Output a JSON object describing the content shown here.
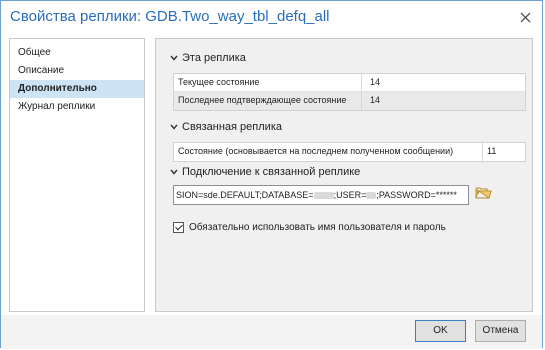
{
  "window": {
    "title": "Свойства реплики: GDB.Two_way_tbl_defq_all"
  },
  "nav": {
    "items": [
      {
        "label": "Общее",
        "active": false
      },
      {
        "label": "Описание",
        "active": false
      },
      {
        "label": "Дополнительно",
        "active": true
      },
      {
        "label": "Журнал реплики",
        "active": false
      }
    ]
  },
  "this_replica": {
    "heading": "Эта реплика",
    "rows": [
      {
        "key": "Текущее состояние",
        "value": "14"
      },
      {
        "key": "Последнее подтверждающее состояние",
        "value": "14"
      }
    ]
  },
  "related_replica": {
    "heading": "Связанная реплика",
    "rows": [
      {
        "key": "Состояние (основывается на последнем полученном сообщении)",
        "value": "11"
      }
    ]
  },
  "connection": {
    "heading": "Подключение к связанной реплике",
    "value_part1": "SION=sde.DEFAULT;DATABASE=",
    "value_part2": ";USER=",
    "value_part3": ";PASSWORD=******"
  },
  "checkbox": {
    "label": "Обязательно использовать имя пользователя и пароль",
    "checked": true
  },
  "footer": {
    "ok_label": "OK",
    "cancel_label": "Отмена"
  },
  "colors": {
    "title": "#2a6ebb",
    "selection": "#cde4f7",
    "folder": "#e8b84a"
  },
  "icons": {
    "close": "close-icon",
    "chevron": "chevron-down-icon",
    "folder": "folder-icon"
  }
}
